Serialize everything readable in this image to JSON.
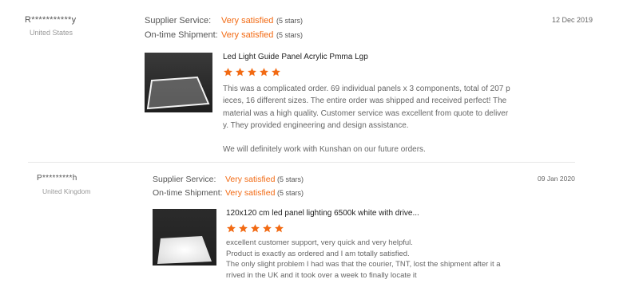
{
  "reviews": [
    {
      "buyer": "R***********y",
      "country": "United States",
      "supplier_service_label": "Supplier Service:",
      "supplier_service_value": "Very satisfied",
      "supplier_service_stars": "(5 stars)",
      "shipment_label": "On-time Shipment:",
      "shipment_value": "Very satisfied",
      "shipment_stars": "(5 stars)",
      "date": "12 Dec 2019",
      "product_title": "Led Light Guide Panel Acrylic Pmma Lgp",
      "rating": 5,
      "text_lines": [
        "This was a complicated order. 69 individual panels x 3 components, total of 207 p",
        "ieces, 16 different sizes.  The entire order was shipped and received perfect! The",
        "material was a high quality. Customer service was excellent from quote to deliver",
        "y. They provided engineering and design assistance.",
        "",
        "We will definitely work with Kunshan on our future orders."
      ]
    },
    {
      "buyer": "P*********h",
      "country": "United Kingdom",
      "supplier_service_label": "Supplier Service:",
      "supplier_service_value": "Very satisfied",
      "supplier_service_stars": "(5 stars)",
      "shipment_label": "On-time Shipment:",
      "shipment_value": "Very satisfied",
      "shipment_stars": "(5 stars)",
      "date": "09 Jan 2020",
      "product_title": "120x120 cm led panel lighting 6500k white with drive...",
      "rating": 5,
      "text_lines": [
        "excellent customer support, very quick and very helpful.",
        "Product is exactly as ordered and I am totally satisfied.",
        "The only slight problem I had was that the courier, TNT, lost the shipment after it a",
        "rrived in the UK and it took over a week to finally locate it"
      ]
    }
  ],
  "colors": {
    "accent": "#f26a13",
    "star": "#f26a13"
  },
  "icons": {
    "star": "star-icon"
  }
}
